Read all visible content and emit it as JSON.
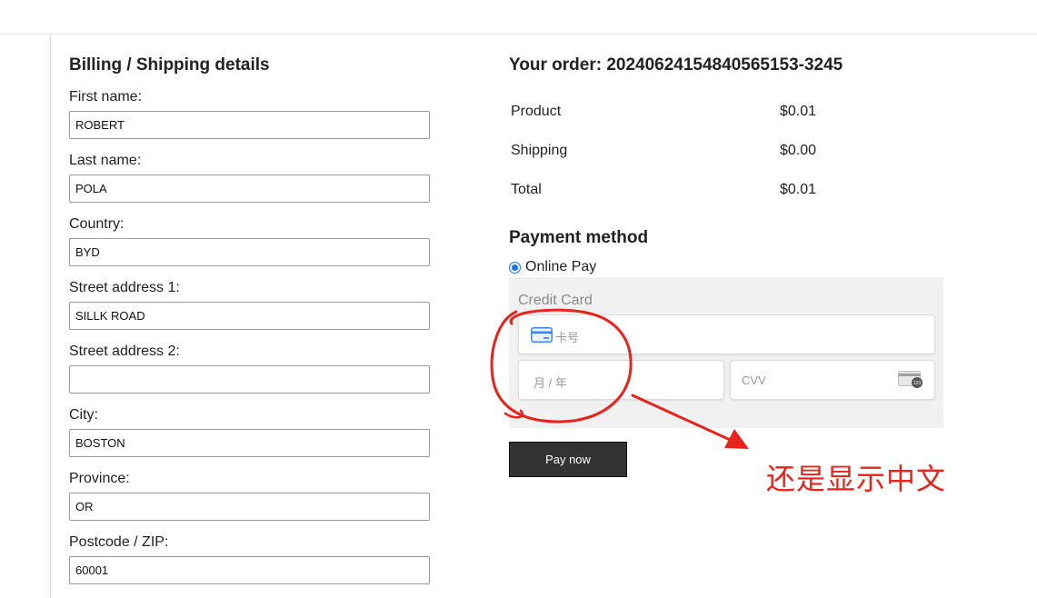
{
  "billing": {
    "title": "Billing / Shipping details",
    "fields": [
      {
        "label": "First name:",
        "value": "ROBERT"
      },
      {
        "label": "Last name:",
        "value": "POLA"
      },
      {
        "label": "Country:",
        "value": "BYD"
      },
      {
        "label": "Street address 1:",
        "value": "SILLK ROAD"
      },
      {
        "label": "Street address 2:",
        "value": ""
      },
      {
        "label": "City:",
        "value": "BOSTON"
      },
      {
        "label": "Province:",
        "value": "OR"
      },
      {
        "label": "Postcode / ZIP:",
        "value": "60001"
      }
    ]
  },
  "order": {
    "title": "Your order:  20240624154840565153-3245",
    "rows": [
      {
        "label": "Product",
        "value": "$0.01"
      },
      {
        "label": "Shipping",
        "value": "$0.00"
      },
      {
        "label": "Total",
        "value": "$0.01"
      }
    ]
  },
  "payment": {
    "title": "Payment method",
    "option_label": "Online Pay",
    "card_title": "Credit Card",
    "card_number_placeholder": "卡号",
    "expiry_placeholder": "月 / 年",
    "cvv_placeholder": "CVV",
    "cvv_badge": "123",
    "pay_button": "Pay now"
  },
  "annotation": {
    "text": "还是显示中文",
    "color": "#e8231b"
  },
  "icons": {
    "card": "credit-card-icon",
    "cvv": "cvv-card-icon"
  }
}
